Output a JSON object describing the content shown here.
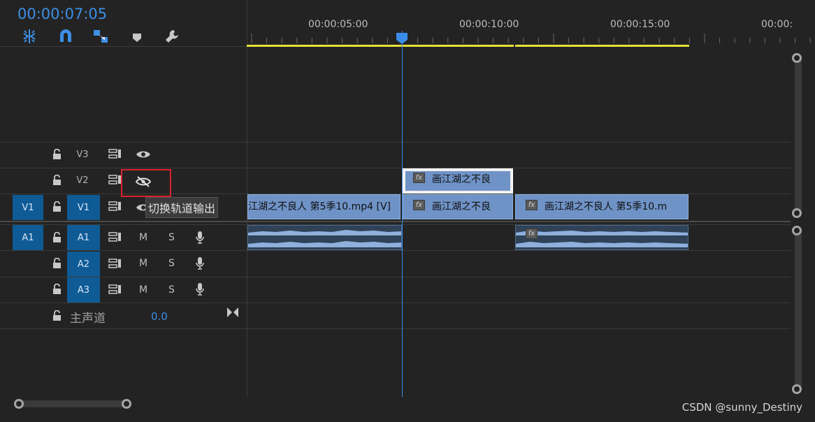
{
  "timecode": "00:00:07:05",
  "ruler": {
    "labels": [
      "00:00:05:00",
      "00:00:10:00",
      "00:00:15:00",
      "00:00:"
    ]
  },
  "tools": [
    "ripple-edit-icon",
    "snap-magnet-icon",
    "linked-selection-icon",
    "marker-icon",
    "wrench-icon"
  ],
  "tracks": {
    "v3": {
      "name": "V3"
    },
    "v2": {
      "name": "V2"
    },
    "v1": {
      "source": "V1",
      "name": "V1"
    },
    "a1": {
      "source": "A1",
      "name": "A1",
      "mute": "M",
      "solo": "S"
    },
    "a2": {
      "name": "A2",
      "mute": "M",
      "solo": "S"
    },
    "a3": {
      "name": "A3",
      "mute": "M",
      "solo": "S"
    },
    "master": {
      "name": "主声道",
      "value": "0.0"
    }
  },
  "clips": {
    "v1_main": "江湖之不良人 第5季10.mp4 [V]",
    "v1_title": "画江湖之不良",
    "v1_right": "画江湖之不良人 第5季10.m",
    "v2_title": "画江湖之不良",
    "fx_label": "fx"
  },
  "tooltip": "切换轨道输出",
  "watermark": "CSDN @sunny_Destiny",
  "colors": {
    "accent": "#3d8ee6",
    "target_blue": "#0f5b96",
    "video_clip": "#6f93c7",
    "work_area": "#e6df3a",
    "highlight_red": "#d9232d"
  }
}
